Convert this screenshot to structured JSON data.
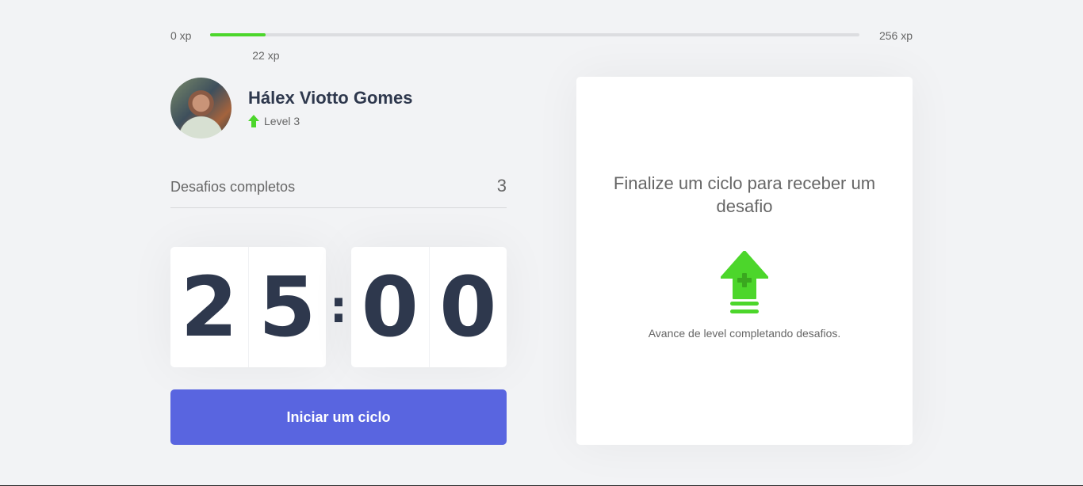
{
  "xp": {
    "min_label": "0 xp",
    "max_label": "256 xp",
    "current_label": "22 xp",
    "current": 22,
    "max": 256,
    "fill_color": "#4cd62b"
  },
  "profile": {
    "name": "Hálex Viotto Gomes",
    "level_label": "Level 3",
    "level_icon": "level-up-arrow-icon"
  },
  "completed": {
    "label": "Desafios completos",
    "count": "3"
  },
  "countdown": {
    "minute_left": "2",
    "minute_right": "5",
    "separator": ":",
    "second_left": "0",
    "second_right": "0"
  },
  "start_button": {
    "label": "Iniciar um ciclo",
    "color": "#5965e0"
  },
  "challenge": {
    "title": "Finalize um ciclo para receber um desafio",
    "icon": "level-up-icon",
    "hint": "Avance de level completando desafios."
  }
}
